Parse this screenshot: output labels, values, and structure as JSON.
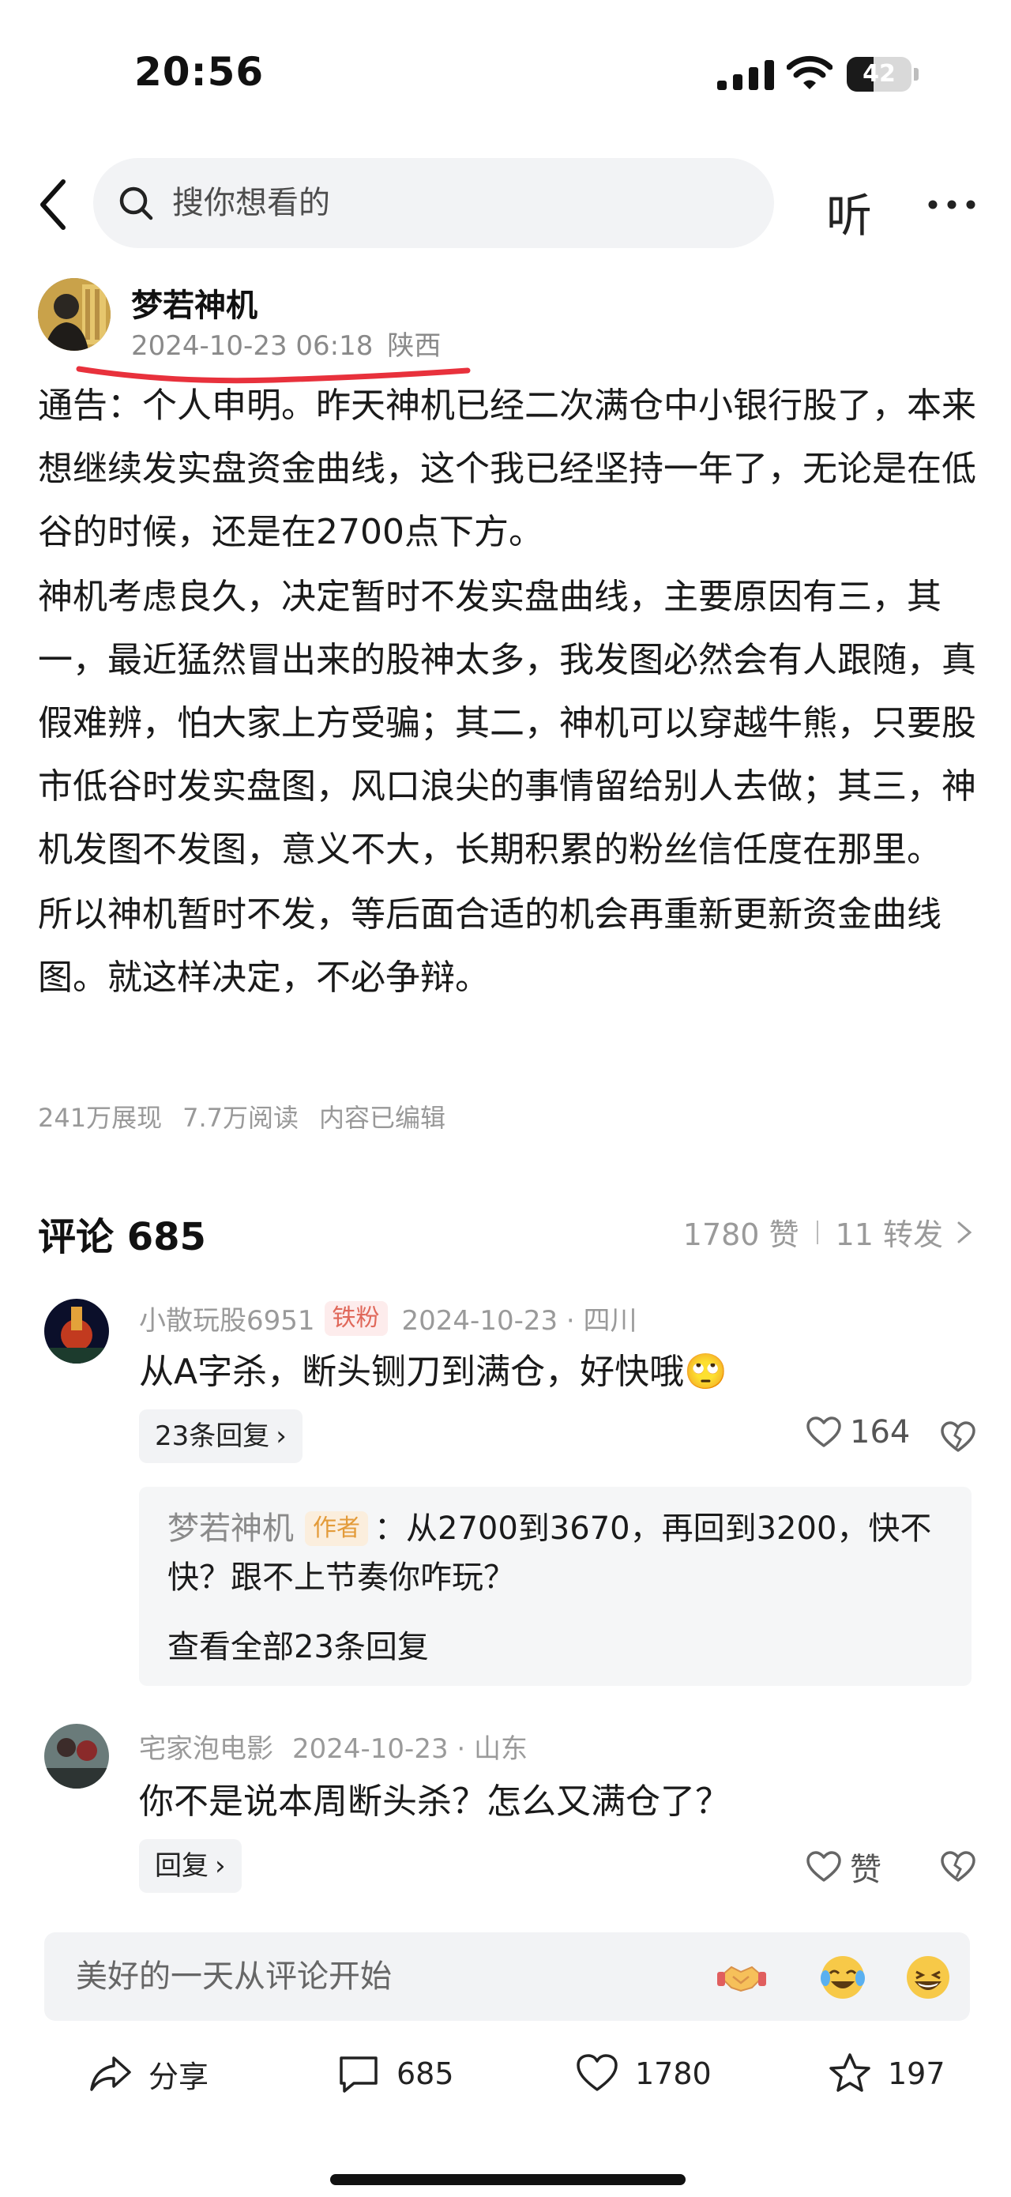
{
  "status_bar": {
    "time": "20:56",
    "battery": "42",
    "battery_level": 0.42
  },
  "nav": {
    "search_placeholder": "搜你想看的",
    "listen_label": "听"
  },
  "author": {
    "name": "梦若神机",
    "date": "2024-10-23 06:18",
    "location": "陕西"
  },
  "post": {
    "paragraphs": [
      "通告：个人申明。昨天神机已经二次满仓中小银行股了，本来想继续发实盘资金曲线，这个我已经坚持一年了，无论是在低谷的时候，还是在2700点下方。",
      "神机考虑良久，决定暂时不发实盘曲线，主要原因有三，其一，最近猛然冒出来的股神太多，我发图必然会有人跟随，真假难辨，怕大家上方受骗；其二，神机可以穿越牛熊，只要股市低谷时发实盘图，风口浪尖的事情留给别人去做；其三，神机发图不发图，意义不大，长期积累的粉丝信任度在那里。",
      "所以神机暂时不发，等后面合适的机会再重新更新资金曲线图。就这样决定，不必争辩。"
    ],
    "stats": {
      "views": "241万展现",
      "reads": "7.7万阅读",
      "edited": "内容已编辑"
    }
  },
  "comments_header": {
    "title": "评论 685",
    "likes": "1780 赞",
    "shares": "11 转发"
  },
  "comments": [
    {
      "user": "小散玩股6951",
      "badge": "铁粉",
      "date": "2024-10-23 · 四川",
      "text": "从A字杀，断头铡刀到满仓，好快哦🙄",
      "reply_label": "23条回复",
      "likes": "164",
      "reply": {
        "author": "梦若神机",
        "author_badge": "作者",
        "text": "：从2700到3670，再回到3200，快不快？跟不上节奏你咋玩？",
        "view_all": "查看全部23条回复"
      }
    },
    {
      "user": "宅家泡电影",
      "date": "2024-10-23 · 山东",
      "text": "你不是说本周断头杀？怎么又满仓了？",
      "reply_label": "回复",
      "likes": "赞"
    }
  ],
  "comment_input": {
    "placeholder": "美好的一天从评论开始",
    "emojis": [
      "handshake-emoji",
      "crying-laughing-emoji",
      "grinning-emoji"
    ]
  },
  "actions": {
    "share": "分享",
    "comments": "685",
    "likes": "1780",
    "favorites": "197"
  }
}
